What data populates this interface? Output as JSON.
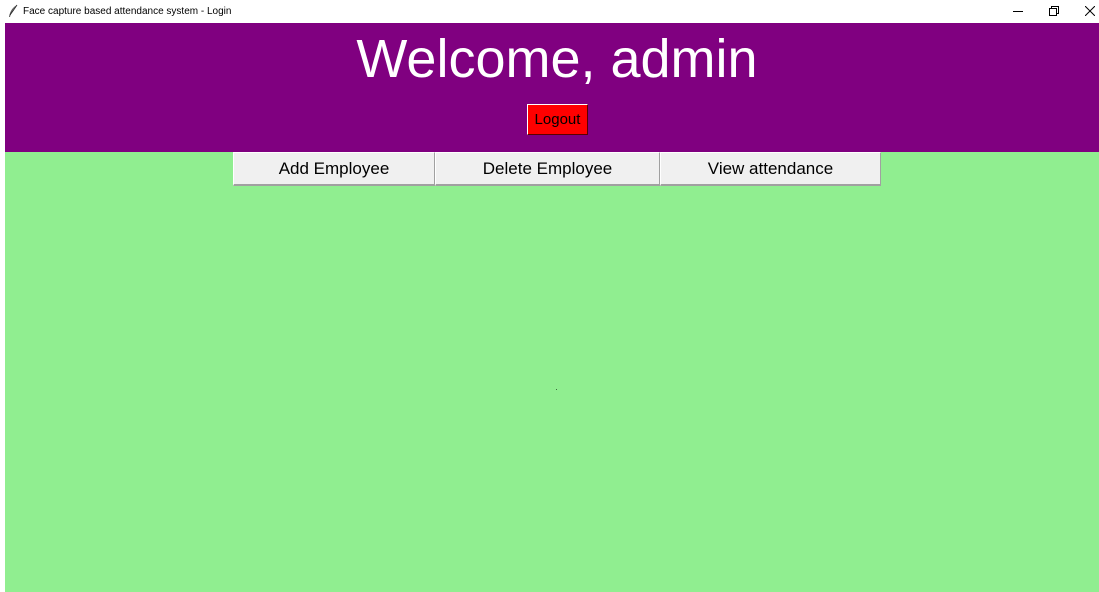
{
  "window": {
    "title": "Face capture based attendance system - Login",
    "app_icon": "feather-icon",
    "controls": [
      "minimize-icon",
      "restore-icon",
      "close-icon"
    ]
  },
  "header": {
    "welcome_text": "Welcome, admin",
    "logout_label": "Logout"
  },
  "nav": {
    "add_employee_label": "Add Employee",
    "delete_employee_label": "Delete Employee",
    "view_attendance_label": "View attendance"
  },
  "colors": {
    "header_bg": "#800080",
    "content_bg": "#90ee90",
    "logout_bg": "#ff0000",
    "button_bg": "#f0f0f0"
  }
}
